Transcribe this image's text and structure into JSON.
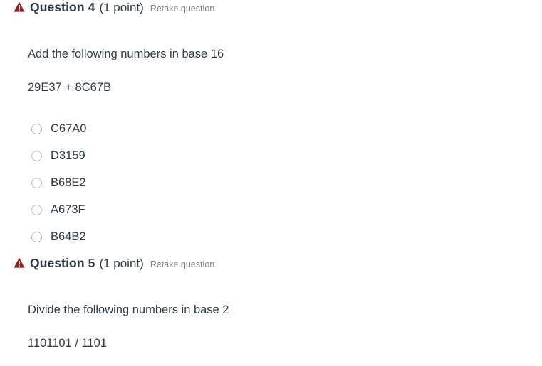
{
  "colors": {
    "page_background": "#ffffff",
    "text": "#2d3b45",
    "warning_icon": "#9c1c1c",
    "muted_link": "#7b8487",
    "radio_border": "#b7bdbf"
  },
  "questions": [
    {
      "icon": "warning-triangle-icon",
      "title": "Question 4",
      "points": "(1 point)",
      "retake": "Retake question",
      "prompt": "Add the following numbers in base 16",
      "expression": "29E37 + 8C67B",
      "options": [
        {
          "label": "C67A0",
          "selected": false
        },
        {
          "label": "D3159",
          "selected": false
        },
        {
          "label": "B68E2",
          "selected": false
        },
        {
          "label": "A673F",
          "selected": false
        },
        {
          "label": "B64B2",
          "selected": false
        }
      ]
    },
    {
      "icon": "warning-triangle-icon",
      "title": "Question 5",
      "points": "(1 point)",
      "retake": "Retake question",
      "prompt": "Divide the following numbers in base 2",
      "expression": "1101101 / 1101",
      "options": []
    }
  ]
}
